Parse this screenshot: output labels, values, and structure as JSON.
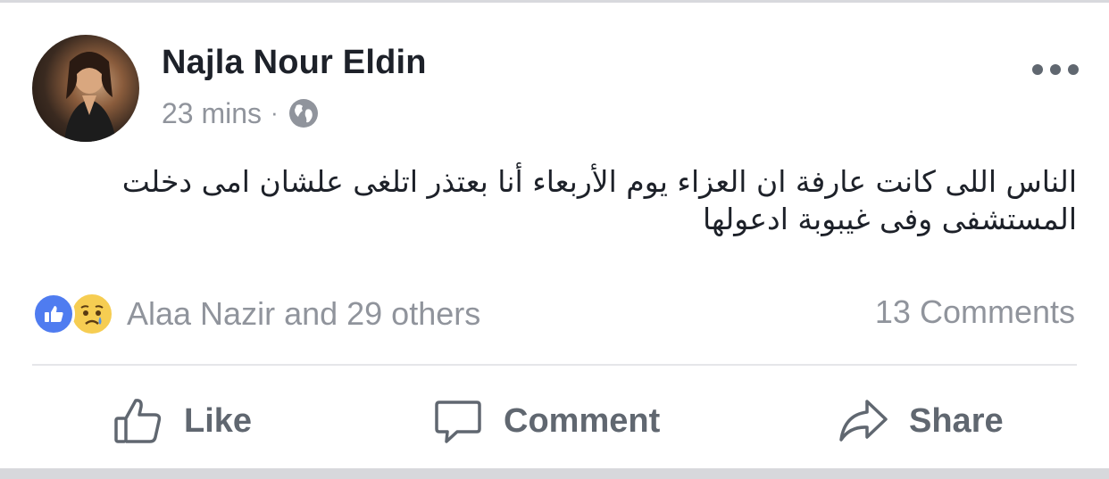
{
  "post": {
    "author": "Najla Nour Eldin",
    "time": "23 mins",
    "separator": "·",
    "privacy_icon": "globe-icon",
    "menu_icon": "more-options-icon",
    "text": "الناس اللى كانت عارفة ان العزاء يوم الأربعاء أنا بعتذر اتلغى علشان امى دخلت المستشفى وفى غيبوبة ادعولها"
  },
  "reactions": {
    "icons": [
      "like-reaction-icon",
      "sad-reaction-icon"
    ],
    "summary": "Alaa Nazir and 29 others",
    "comments": "13 Comments"
  },
  "actions": {
    "like": "Like",
    "comment": "Comment",
    "share": "Share"
  },
  "colors": {
    "name": "#1d2129",
    "secondary": "#90949c",
    "action": "#606770",
    "like_blue": "#4f7cf0",
    "sad_yellow": "#f6cd52"
  }
}
